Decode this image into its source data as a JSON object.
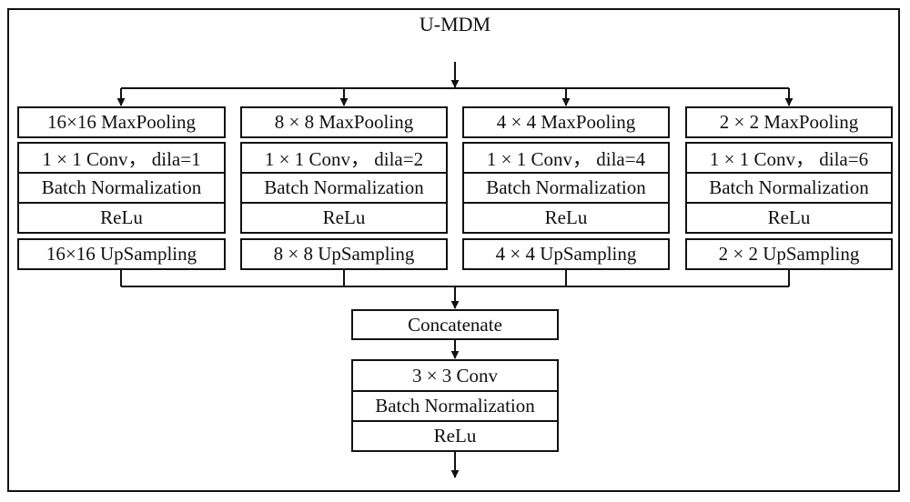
{
  "title": "U-MDM",
  "branches": [
    {
      "pool": "16×16 MaxPooling",
      "conv": "1 × 1 Conv，  dila=1",
      "bn": "Batch Normalization",
      "act": "ReLu",
      "up": "16×16 UpSampling"
    },
    {
      "pool": "8 × 8 MaxPooling",
      "conv": "1 × 1 Conv，  dila=2",
      "bn": "Batch Normalization",
      "act": "ReLu",
      "up": "8 × 8 UpSampling"
    },
    {
      "pool": "4 × 4 MaxPooling",
      "conv": "1 × 1 Conv，  dila=4",
      "bn": "Batch Normalization",
      "act": "ReLu",
      "up": "4 × 4 UpSampling"
    },
    {
      "pool": "2 × 2 MaxPooling",
      "conv": "1 × 1 Conv，  dila=6",
      "bn": "Batch Normalization",
      "act": "ReLu",
      "up": "2 × 2 UpSampling"
    }
  ],
  "merge": {
    "concat": "Concatenate",
    "conv": "3 × 3 Conv",
    "bn": "Batch Normalization",
    "act": "ReLu"
  }
}
